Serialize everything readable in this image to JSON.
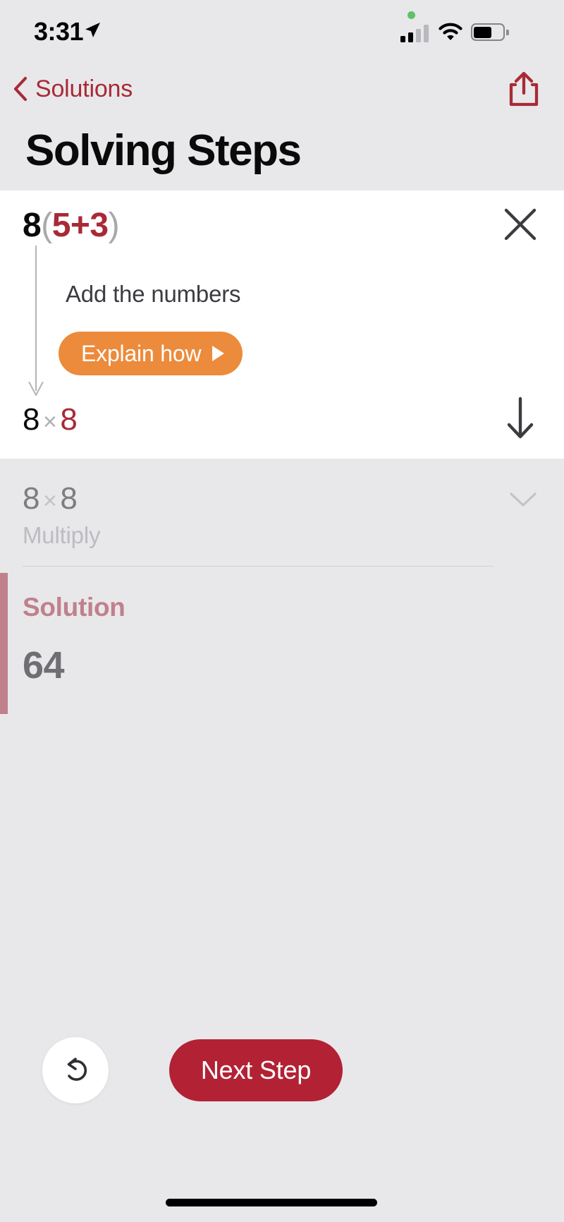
{
  "status_bar": {
    "time": "3:31",
    "location_icon": "location-arrow-icon",
    "privacy_indicator": "green-recording-dot",
    "signal_icon": "cellular-signal-icon",
    "signal_bars_filled": 2,
    "signal_bars_total": 4,
    "wifi_icon": "wifi-icon",
    "battery_icon": "battery-icon",
    "battery_level_percent": 55
  },
  "nav_bar": {
    "back_label": "Solutions",
    "back_icon": "chevron-left-icon",
    "share_icon": "share-up-icon",
    "accent_color": "#a82a37"
  },
  "page_title": "Solving Steps",
  "active_step": {
    "expression": {
      "full_text": "8(5+3)",
      "parts": [
        {
          "text": "8",
          "color": "#0a0a0a"
        },
        {
          "text": "(",
          "color": "#a8a8ad"
        },
        {
          "text": "5",
          "color": "#a82a37"
        },
        {
          "text": "+",
          "color": "#a82a37"
        },
        {
          "text": "3",
          "color": "#a82a37"
        },
        {
          "text": ")",
          "color": "#a8a8ad"
        }
      ]
    },
    "close_icon": "close-x-icon",
    "connector_icon": "down-arrow-connector-icon",
    "description": "Add the numbers",
    "explain_button": {
      "label": "Explain how",
      "caret_icon": "play-caret-icon",
      "color": "#ec8b3c"
    },
    "result": {
      "full_text": "8 × 8",
      "parts": [
        {
          "text": "8",
          "color": "#0a0a0a"
        },
        {
          "text": "×",
          "color": "#b0b0b5"
        },
        {
          "text": "8",
          "color": "#a82a37"
        }
      ]
    },
    "next_arrow_icon": "arrow-down-icon"
  },
  "pending_step": {
    "expression": {
      "full_text": "8 × 8",
      "parts": [
        {
          "text": "8",
          "color": "#7c7c81"
        },
        {
          "text": "×",
          "color": "#c2c2c7"
        },
        {
          "text": "8",
          "color": "#7c7c81"
        }
      ]
    },
    "description": "Multiply",
    "chevron_icon": "chevron-down-icon"
  },
  "solution": {
    "label": "Solution",
    "value": "64",
    "accent_color": "#c0808c"
  },
  "bottom_bar": {
    "undo_icon": "undo-arrow-icon",
    "next_step_label": "Next Step",
    "next_step_color": "#b22234"
  },
  "home_indicator": "home-indicator-bar"
}
